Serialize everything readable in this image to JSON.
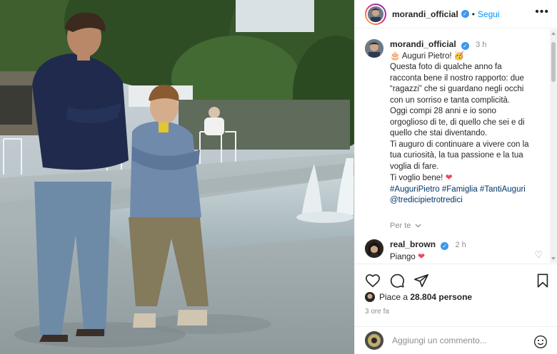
{
  "post": {
    "username": "morandi_official",
    "follow_label": "Segui",
    "separator": "•",
    "time": "3 h",
    "caption_line1": "Auguri Pietro!",
    "caption_body": [
      "Questa foto di qualche anno fa",
      "racconta bene il nostro rapporto: due",
      "“ragazzi” che si guardano negli occhi",
      "con un sorriso e tanta complicità.",
      "Oggi compi 28 anni e io sono",
      "orgoglioso di te, di quello che sei e di",
      "quello che stai diventando.",
      "Ti auguro di continuare a vivere con la",
      "tua curiosità, la tua passione e la tua",
      "voglia di fare."
    ],
    "closing": "Ti voglio bene!",
    "hashtags": "#AuguriPietro #Famiglia #TantiAuguri",
    "mention": "@tredicipietrotredici",
    "see_translation": "Per te"
  },
  "reply": {
    "username": "real_brown",
    "time": "2 h",
    "text": "Piango"
  },
  "likes": {
    "prefix": "Piace a",
    "count": "28.804",
    "suffix": "persone"
  },
  "time_ago": "3 ore fa",
  "add_comment": {
    "placeholder": "Aggiungi un commento..."
  },
  "icons": {
    "more": "more-horizontal-icon",
    "like": "heart-outline-icon",
    "comment": "comment-bubble-icon",
    "share": "paper-plane-icon",
    "save": "bookmark-icon",
    "emoji": "smiley-icon",
    "verified": "verified-badge-icon",
    "heart": "red-heart-icon"
  },
  "colors": {
    "link_blue": "#0095f6",
    "hashtag": "#00376b",
    "verified": "#3897f0",
    "heart": "#ed4956",
    "muted": "#8e8e8e"
  }
}
